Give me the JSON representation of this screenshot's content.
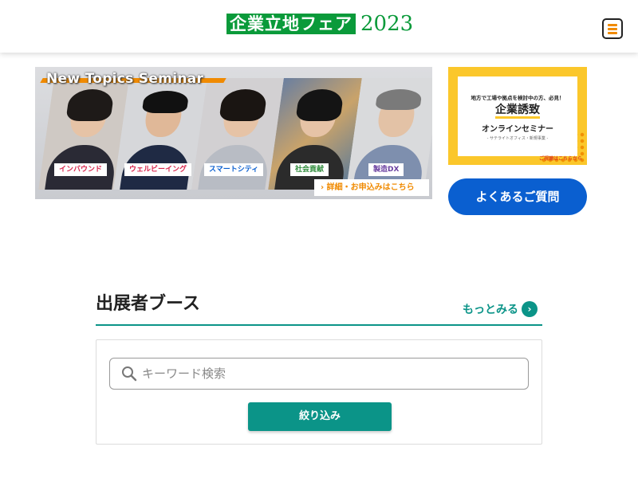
{
  "header": {
    "logo_text": "企業立地フェア",
    "logo_year": "2023",
    "menu_icon": "hamburger-icon"
  },
  "seminar_banner": {
    "title": "New Topics Seminar",
    "tags": [
      {
        "label": "インバウンド",
        "color": "#d8264d"
      },
      {
        "label": "ウェルビーイング",
        "color": "#d8264d"
      },
      {
        "label": "スマートシティ",
        "color": "#0a5fd0"
      },
      {
        "label": "社会貢献",
        "color": "#2e8b3a"
      },
      {
        "label": "製造DX",
        "color": "#6a3fa0"
      }
    ],
    "apply_label": "› 詳細・お申込みはこちら"
  },
  "corp_banner": {
    "small_text": "地方で工場や拠点を検討中の方、必見！",
    "big_text": "企業誘致",
    "mid_text": "オンラインセミナー",
    "tiny_text": "- サテライトオフィス・新規事業 -",
    "link_text": "ご視聴はこちらから"
  },
  "faq_button": {
    "label": "よくあるご質問"
  },
  "exhibitors": {
    "title": "出展者ブース",
    "more_label": "もっとみる",
    "more_icon": "chevron-right-icon",
    "search_placeholder": "キーワード検索",
    "search_value": "",
    "filter_label": "絞り込み"
  },
  "colors": {
    "brand_green": "#0a9a3a",
    "teal": "#0b9488",
    "blue": "#0a5fd0",
    "orange": "#f08a00",
    "yellow": "#fbc72b"
  }
}
